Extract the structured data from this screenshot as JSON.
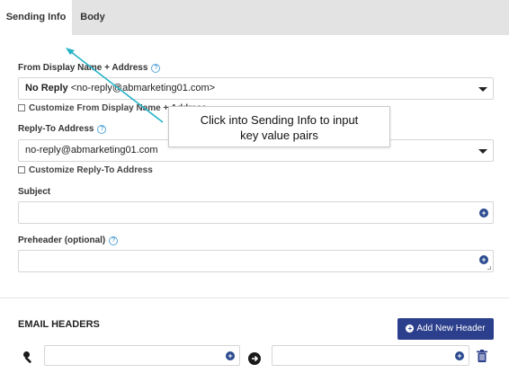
{
  "tabs": [
    {
      "label": "Sending Info"
    },
    {
      "label": "Body"
    }
  ],
  "from": {
    "label": "From Display Name + Address",
    "value_bold": "No Reply",
    "value_rest": "<no-reply@abmarketing01.com>",
    "customize_label": "Customize From Display Name + Address"
  },
  "reply_to": {
    "label": "Reply-To Address",
    "value": "no-reply@abmarketing01.com",
    "customize_label": "Customize Reply-To Address"
  },
  "subject": {
    "label": "Subject",
    "value": ""
  },
  "preheader": {
    "label": "Preheader (optional)",
    "value": ""
  },
  "email_headers": {
    "title": "EMAIL HEADERS",
    "add_button": "Add New Header"
  },
  "tooltip": {
    "line1": "Click into Sending Info to input",
    "line2": "key value pairs"
  },
  "colors": {
    "accent": "#2c3f8c",
    "help": "#5aa6d6",
    "annotation_arrow": "#25b3c7"
  },
  "icons": [
    "help-icon",
    "caret-down-icon",
    "plus-circle-icon",
    "key-icon",
    "arrow-right-circle-icon",
    "trash-icon"
  ]
}
